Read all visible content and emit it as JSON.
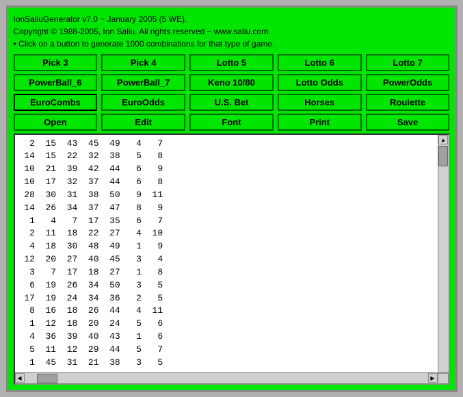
{
  "header": {
    "line1": "IonSaliuGenerator v7.0 ~ January 2005 (5 WE).",
    "line2": "Copyright © 1988-2005, Ion Saliu. All rights reserved ~ www.saliu.com.",
    "line3": "• Click on a button to generate 1000 combinations for that type of game."
  },
  "rows": [
    [
      "row1",
      "Pick 3",
      "Pick 4",
      "Lotto 5",
      "Lotto 6",
      "Lotto 7"
    ],
    [
      "row2",
      "PowerBall_6",
      "PowerBall_7",
      "Keno 10/80",
      "Lotto Odds",
      "PowerOdds"
    ],
    [
      "row3",
      "EuroCombs",
      "EuroOdds",
      "U.S. Bet",
      "Horses",
      "Roulette"
    ],
    [
      "row4",
      "Open",
      "Edit",
      "Font",
      "Print",
      "Save"
    ]
  ],
  "buttons": {
    "r1b1": "Pick 3",
    "r1b2": "Pick 4",
    "r1b3": "Lotto 5",
    "r1b4": "Lotto 6",
    "r1b5": "Lotto 7",
    "r2b1": "PowerBall_6",
    "r2b2": "PowerBall_7",
    "r2b3": "Keno 10/80",
    "r2b4": "Lotto Odds",
    "r2b5": "PowerOdds",
    "r3b1": "EuroCombs",
    "r3b2": "EuroOdds",
    "r3b3": "U.S. Bet",
    "r3b4": "Horses",
    "r3b5": "Roulette",
    "r4b1": "Open",
    "r4b2": "Edit",
    "r4b3": "Font",
    "r4b4": "Print",
    "r4b5": "Save"
  },
  "output": "  2  15  43  45  49   4   7\n 14  15  22  32  38   5   8\n 10  21  39  42  44   6   9\n 10  17  32  37  44   6   8\n 28  30  31  38  50   9  11\n 14  26  34  37  47   8   9\n  1   4   7  17  35   6   7\n  2  11  18  22  27   4  10\n  4  18  30  48  49   1   9\n 12  20  27  40  45   3   4\n  3   7  17  18  27   1   8\n  6  19  26  34  50   3   5\n 17  19  24  34  36   2   5\n  8  16  18  26  44   4  11\n  1  12  18  20  24   5   6\n  4  36  39  40  43   1   6\n  5  11  12  29  44   5   7\n  1  45  31  21  38   3   5"
}
